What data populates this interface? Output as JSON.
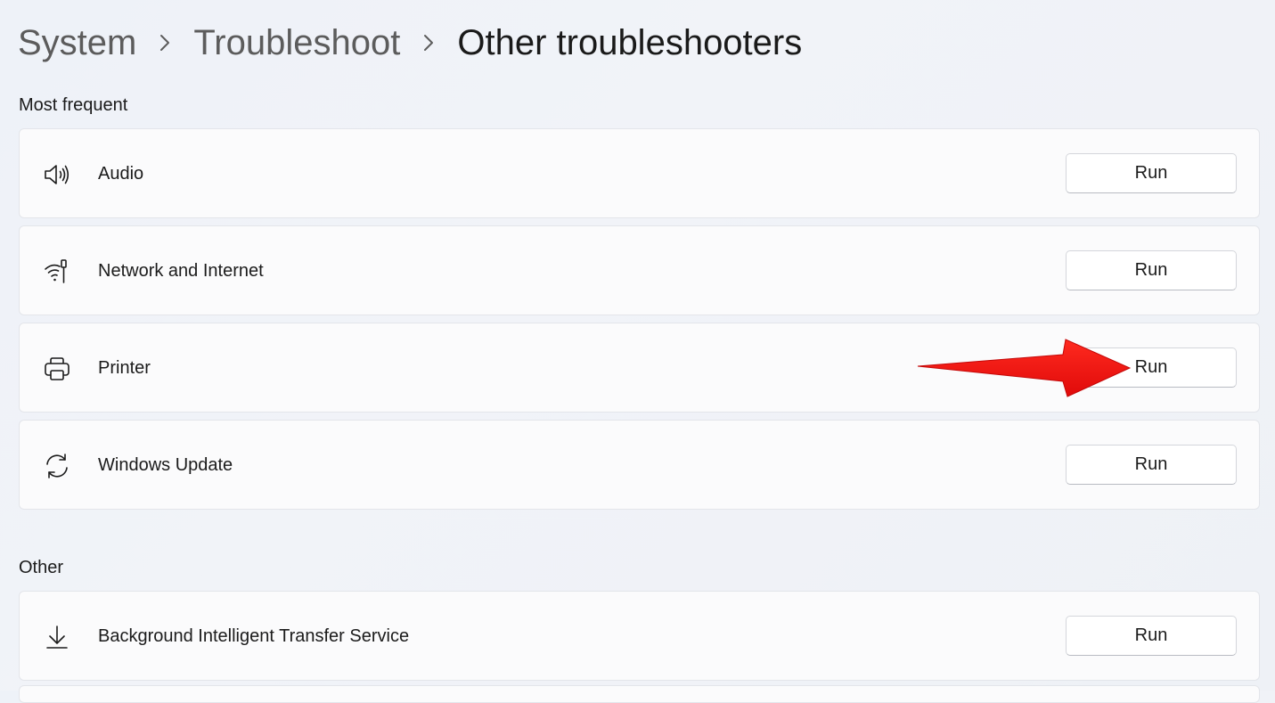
{
  "breadcrumb": {
    "items": [
      "System",
      "Troubleshoot",
      "Other troubleshooters"
    ]
  },
  "sections": {
    "most_frequent": {
      "title": "Most frequent",
      "items": [
        {
          "label": "Audio",
          "icon": "speaker-icon",
          "button": "Run"
        },
        {
          "label": "Network and Internet",
          "icon": "wifi-network-icon",
          "button": "Run"
        },
        {
          "label": "Printer",
          "icon": "printer-icon",
          "button": "Run"
        },
        {
          "label": "Windows Update",
          "icon": "sync-icon",
          "button": "Run"
        }
      ]
    },
    "other": {
      "title": "Other",
      "items": [
        {
          "label": "Background Intelligent Transfer Service",
          "icon": "download-icon",
          "button": "Run"
        }
      ]
    }
  },
  "annotation": {
    "arrow_color": "#f20d0d",
    "icon": "red-arrow-annotation"
  },
  "colors": {
    "background": "#eef2f8",
    "card": "#fbfbfc",
    "breadcrumb_inactive": "#5c5c5c",
    "text": "#1b1b1b"
  }
}
